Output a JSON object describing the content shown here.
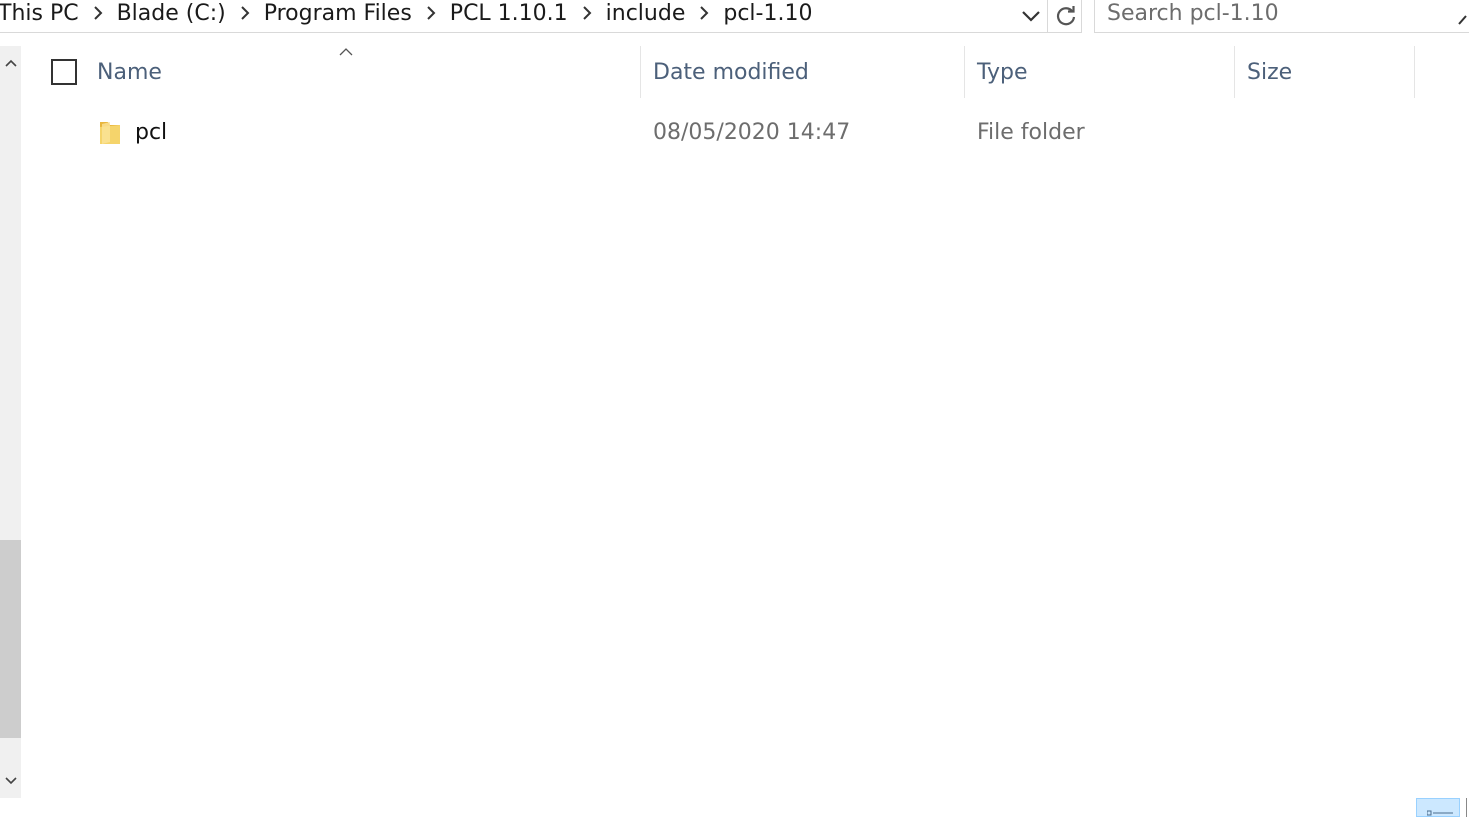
{
  "address_bar": {
    "breadcrumbs": [
      {
        "label": "This PC"
      },
      {
        "label": "Blade (C:)"
      },
      {
        "label": "Program Files"
      },
      {
        "label": "PCL 1.10.1"
      },
      {
        "label": "include"
      },
      {
        "label": "pcl-1.10"
      }
    ],
    "dropdown_icon": "chevron-down-icon",
    "refresh_icon": "refresh-icon"
  },
  "search": {
    "placeholder": "Search pcl-1.10",
    "value": "",
    "icon": "search-icon"
  },
  "columns": {
    "name": "Name",
    "date_modified": "Date modified",
    "type": "Type",
    "size": "Size",
    "sorted_by": "Name",
    "sort_direction": "ascending"
  },
  "files": [
    {
      "name": "pcl",
      "date_modified": "08/05/2020 14:47",
      "type": "File folder",
      "size": "",
      "icon": "folder-icon"
    }
  ],
  "view_mode": "details",
  "colors": {
    "header_text": "#4c607a",
    "secondary_text": "#6d6d6d",
    "selected_view_bg": "#cce8ff",
    "folder_yellow": "#f5d46b"
  }
}
